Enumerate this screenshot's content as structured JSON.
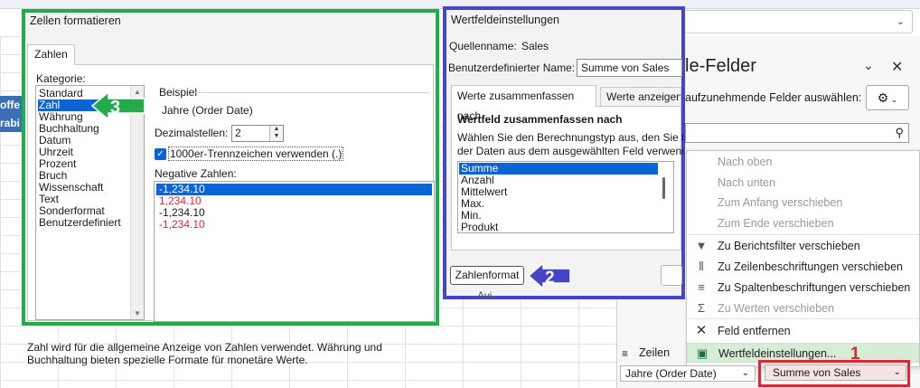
{
  "sheet": {
    "left_cells": [
      "offe",
      "rabi"
    ]
  },
  "pivot_pane": {
    "title": "le-Felder",
    "subtitle": "aufzunehmende Felder auswählen:",
    "context_menu": [
      {
        "label": "Nach oben",
        "disabled": true,
        "icon": ""
      },
      {
        "label": "Nach unten",
        "disabled": true,
        "icon": ""
      },
      {
        "label": "Zum Anfang verschieben",
        "disabled": true,
        "icon": ""
      },
      {
        "label": "Zum Ende verschieben",
        "disabled": true,
        "icon": ""
      },
      {
        "label": "Zu Berichtsfilter verschieben",
        "disabled": false,
        "icon": "filter-icon"
      },
      {
        "label": "Zu Zeilenbeschriftungen verschieben",
        "disabled": false,
        "icon": "rows-icon"
      },
      {
        "label": "Zu Spaltenbeschriftungen verschieben",
        "disabled": false,
        "icon": "columns-icon"
      },
      {
        "label": "Zu Werten verschieben",
        "disabled": true,
        "icon": "sigma-icon"
      },
      {
        "label": "Feld entfernen",
        "disabled": false,
        "icon": "remove-icon"
      },
      {
        "label": "Wertfeldeinstellungen...",
        "disabled": false,
        "icon": "settings-icon"
      }
    ],
    "zeilen_label": "Zeilen",
    "zeilen_field": "Jahre (Order Date)",
    "werte_field": "Summe von Sales",
    "annotation_1": "1"
  },
  "dialog_format": {
    "title": "Zellen formatieren",
    "tab": "Zahlen",
    "category_label": "Kategorie:",
    "categories": [
      "Standard",
      "Zahl",
      "Währung",
      "Buchhaltung",
      "Datum",
      "Uhrzeit",
      "Prozent",
      "Bruch",
      "Wissenschaft",
      "Text",
      "Sonderformat",
      "Benutzerdefiniert"
    ],
    "selected_category": "Zahl",
    "example_label": "Beispiel",
    "example_value": "Jahre (Order Date)",
    "decimals_label": "Dezimalstellen:",
    "decimals_value": "2",
    "thousands_label": "1000er-Trennzeichen verwenden (.)",
    "negative_label": "Negative Zahlen:",
    "negatives": [
      "-1,234.10",
      "1,234.10",
      "-1,234.10",
      "-1,234.10"
    ],
    "description": "Zahl wird für die allgemeine Anzeige von Zahlen verwendet. Währung und Buchhaltung bieten spezielle Formate für monetäre Werte.",
    "annotation_3": "3"
  },
  "dialog_value": {
    "title": "Wertfeldeinstellungen",
    "source_label": "Quellenname:",
    "source_value": "Sales",
    "custom_name_label": "Benutzerdefinierter Name:",
    "custom_name_value": "Summe von Sales",
    "tab_summarize": "Werte zusammenfassen nach",
    "tab_show": "Werte anzeigen",
    "summarize_heading": "Wertfeld zusammenfassen nach",
    "summarize_desc_1": "Wählen Sie den Berechnungstyp aus, den Sie für",
    "summarize_desc_2": "der Daten aus dem ausgewählten Feld verwende",
    "functions": [
      "Summe",
      "Anzahl",
      "Mittelwert",
      "Max.",
      "Min.",
      "Produkt"
    ],
    "number_format_button": "Zahlenformat",
    "annotation_2": "2",
    "behind_label": "Avi"
  },
  "colors": {
    "green": "#22ab4b",
    "blue": "#4545c8",
    "red": "#e3262e",
    "select": "#0a64d6"
  }
}
